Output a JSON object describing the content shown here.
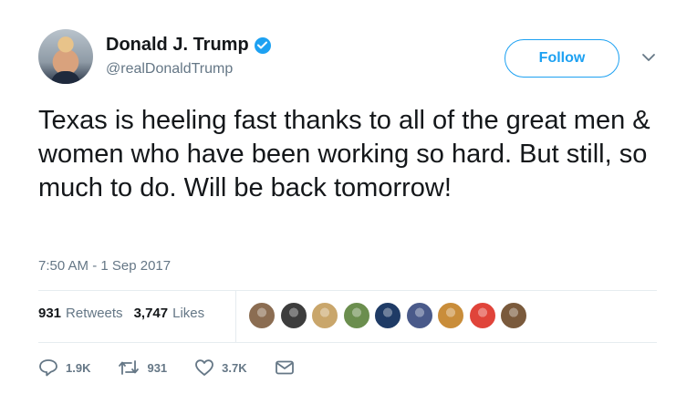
{
  "user": {
    "display_name": "Donald J. Trump",
    "handle": "@realDonaldTrump",
    "verified": true
  },
  "header": {
    "follow_label": "Follow"
  },
  "tweet": {
    "text": "Texas is heeling fast thanks to all of the great men & women who have been working so hard. But still, so much to do. Will be back tomorrow!",
    "timestamp": "7:50 AM - 1 Sep 2017"
  },
  "stats": {
    "retweets_count": "931",
    "retweets_label": "Retweets",
    "likes_count": "3,747",
    "likes_label": "Likes"
  },
  "likers": [
    {
      "icon": "liker-avatar",
      "color": "#8b6d52"
    },
    {
      "icon": "liker-avatar",
      "color": "#3d3d3d"
    },
    {
      "icon": "liker-avatar",
      "color": "#c9a66b"
    },
    {
      "icon": "liker-avatar",
      "color": "#6b8e4e"
    },
    {
      "icon": "liker-avatar",
      "color": "#1f3b66"
    },
    {
      "icon": "liker-avatar",
      "color": "#4a5a8a"
    },
    {
      "icon": "liker-avatar",
      "color": "#c98d3a"
    },
    {
      "icon": "liker-avatar",
      "color": "#e0443a"
    },
    {
      "icon": "liker-avatar",
      "color": "#7a5a3c"
    }
  ],
  "actions": {
    "reply_count": "1.9K",
    "retweet_count": "931",
    "like_count": "3.7K"
  },
  "colors": {
    "accent": "#1da1f2",
    "secondary_text": "#657786",
    "primary_text": "#14171a",
    "divider": "#e6ecf0"
  }
}
